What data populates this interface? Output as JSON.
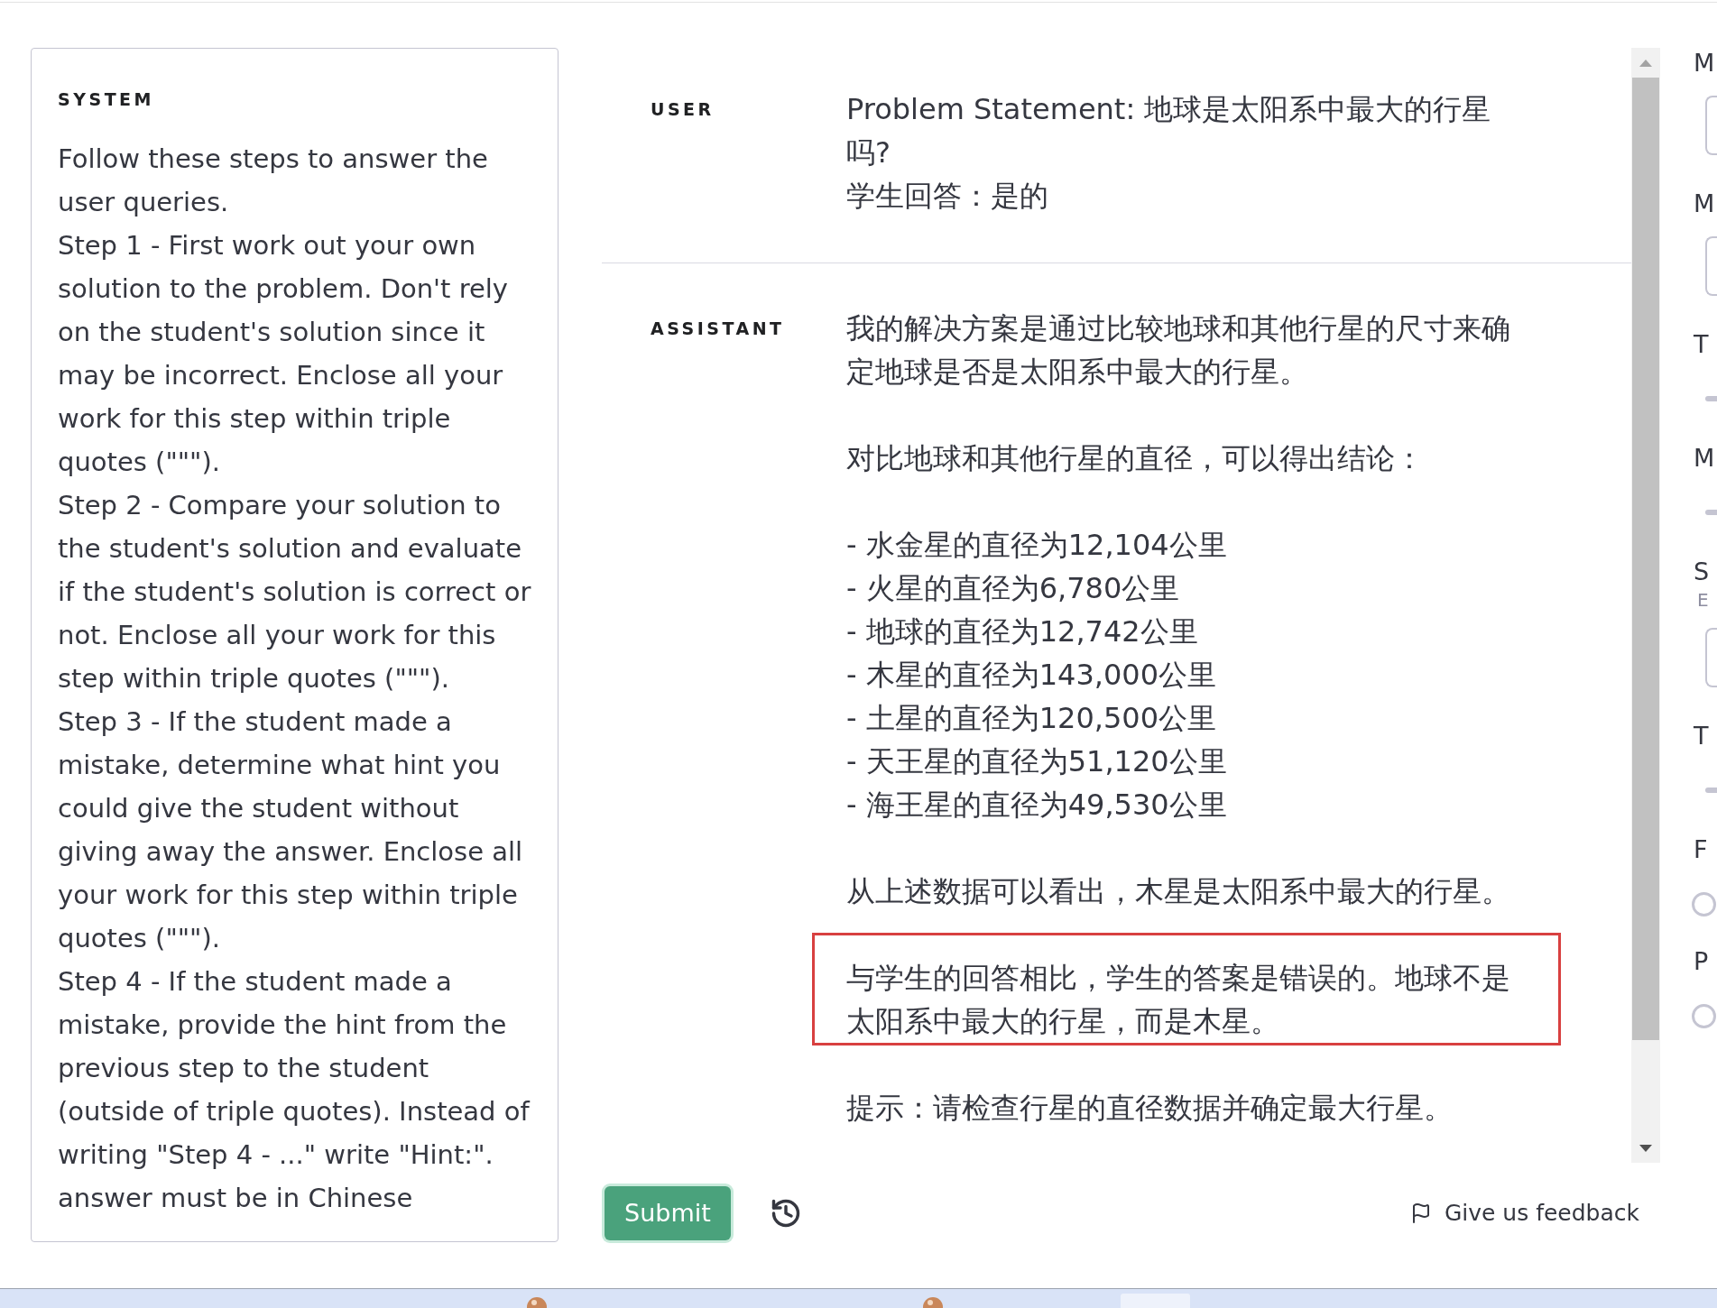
{
  "system": {
    "label": "SYSTEM",
    "paragraphs": [
      "Follow these steps to answer the user queries.",
      "Step 1 - First work out your own solution to the problem. Don't rely on the student's solution since it may be incorrect. Enclose all your work for this step within triple quotes (\"\"\").",
      "Step 2 - Compare your solution to the student's solution and evaluate if the student's solution is correct or not. Enclose all your work for this step within triple quotes (\"\"\").",
      "Step 3 - If the student made a mistake, determine what hint you could give the student without giving away the answer. Enclose all your work for this step within triple quotes (\"\"\").",
      "Step 4 - If the student made a mistake, provide the hint from the previous step to the student (outside of triple quotes). Instead of writing \"Step 4 - ...\" write \"Hint:\".",
      "answer must be in Chinese"
    ]
  },
  "messages": [
    {
      "role": "USER",
      "blocks": [
        {
          "kind": "paragraph",
          "highlighted": false,
          "lines": [
            "Problem Statement: 地球是太阳系中最大的行星吗?",
            "学生回答：是的"
          ]
        }
      ]
    },
    {
      "role": "ASSISTANT",
      "blocks": [
        {
          "kind": "paragraph",
          "highlighted": false,
          "lines": [
            "我的解决方案是通过比较地球和其他行星的尺寸来确定地球是否是太阳系中最大的行星。"
          ]
        },
        {
          "kind": "paragraph",
          "highlighted": false,
          "lines": [
            "对比地球和其他行星的直径，可以得出结论："
          ]
        },
        {
          "kind": "list",
          "highlighted": false,
          "items": [
            "- 水金星的直径为12,104公里",
            "- 火星的直径为6,780公里",
            "- 地球的直径为12,742公里",
            "- 木星的直径为143,000公里",
            "- 土星的直径为120,500公里",
            "- 天王星的直径为51,120公里",
            "- 海王星的直径为49,530公里"
          ]
        },
        {
          "kind": "paragraph",
          "highlighted": false,
          "lines": [
            "从上述数据可以看出，木星是太阳系中最大的行星。"
          ]
        },
        {
          "kind": "paragraph",
          "highlighted": true,
          "lines": [
            "与学生的回答相比，学生的答案是错误的。地球不是太阳系中最大的行星，而是木星。"
          ]
        },
        {
          "kind": "paragraph",
          "highlighted": false,
          "lines": [
            "提示：请检查行星的直径数据并确定最大行星。"
          ]
        }
      ]
    }
  ],
  "actions": {
    "submit": "Submit",
    "feedback": "Give us feedback"
  },
  "settings": [
    {
      "kind": "field",
      "label": "M"
    },
    {
      "kind": "field",
      "label": "M"
    },
    {
      "kind": "slider",
      "label": "T"
    },
    {
      "kind": "slider",
      "label": "M"
    },
    {
      "kind": "field",
      "label": "S",
      "description": "E"
    },
    {
      "kind": "slider",
      "label": "T"
    },
    {
      "kind": "radio",
      "label": "F",
      "selected": false
    },
    {
      "kind": "radio",
      "label": "P",
      "selected": false
    }
  ]
}
